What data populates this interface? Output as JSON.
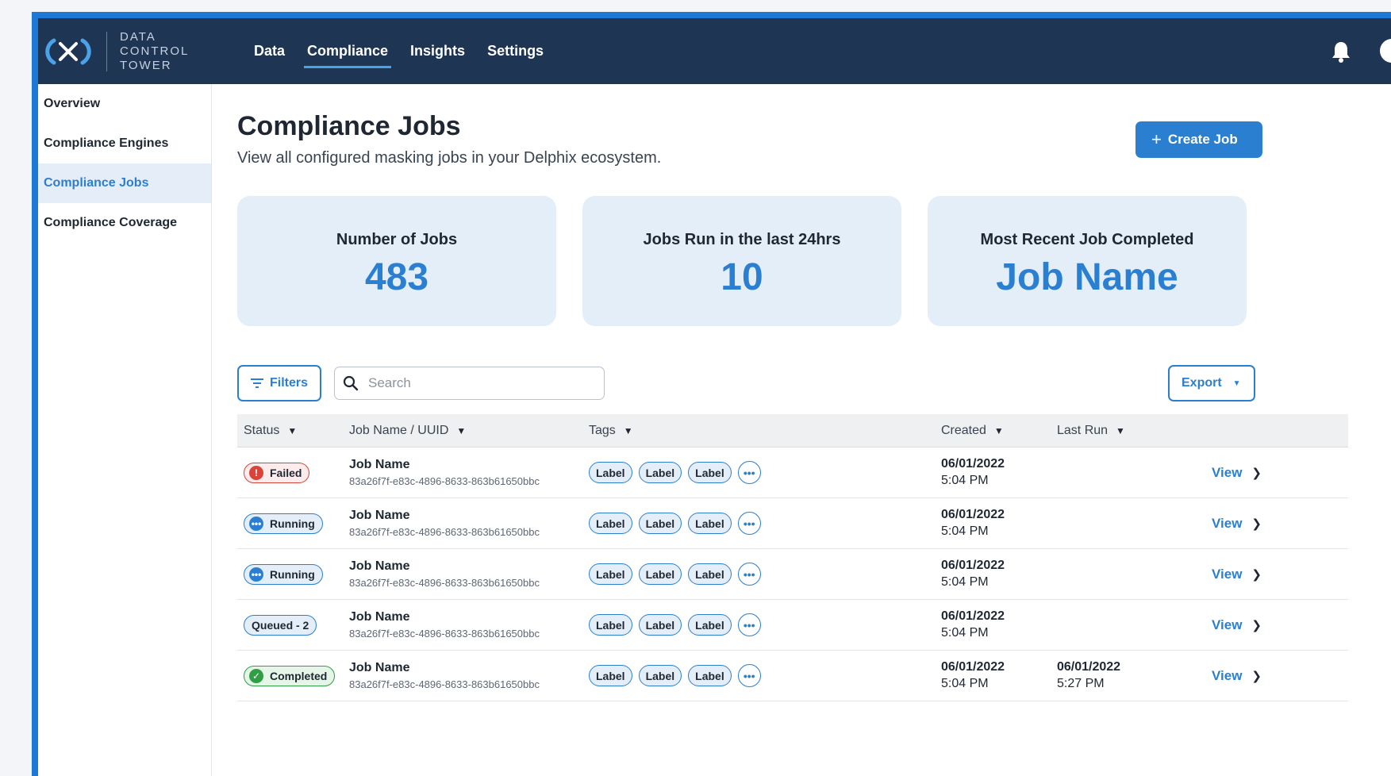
{
  "header": {
    "logo_line1": "DATA",
    "logo_line2": "CONTROL",
    "logo_line3": "TOWER",
    "nav": [
      {
        "label": "Data",
        "active": false
      },
      {
        "label": "Compliance",
        "active": true
      },
      {
        "label": "Insights",
        "active": false
      },
      {
        "label": "Settings",
        "active": false
      }
    ]
  },
  "sidebar": {
    "items": [
      {
        "label": "Overview"
      },
      {
        "label": "Compliance Engines"
      },
      {
        "label": "Compliance Jobs",
        "active": true
      },
      {
        "label": "Compliance Coverage"
      }
    ]
  },
  "page": {
    "title": "Compliance Jobs",
    "subtitle": "View all configured masking jobs in your Delphix ecosystem.",
    "create_label": "Create Job"
  },
  "stats": [
    {
      "label": "Number of Jobs",
      "value": "483"
    },
    {
      "label": "Jobs Run in the last 24hrs",
      "value": "10"
    },
    {
      "label": "Most Recent Job Completed",
      "value": "Job Name"
    }
  ],
  "toolbar": {
    "filters_label": "Filters",
    "search_placeholder": "Search",
    "export_label": "Export"
  },
  "table": {
    "headers": {
      "status": "Status",
      "job": "Job Name / UUID",
      "tags": "Tags",
      "created": "Created",
      "last_run": "Last Run"
    },
    "rows": [
      {
        "status": "Failed",
        "status_type": "failed",
        "name": "Job Name",
        "uuid": "83a26f7f-e83c-4896-8633-863b61650bbc",
        "tags": [
          "Label",
          "Label",
          "Label"
        ],
        "created_date": "06/01/2022",
        "created_time": "5:04 PM",
        "last_date": "",
        "last_time": "",
        "action": "View"
      },
      {
        "status": "Running",
        "status_type": "running",
        "name": "Job Name",
        "uuid": "83a26f7f-e83c-4896-8633-863b61650bbc",
        "tags": [
          "Label",
          "Label",
          "Label"
        ],
        "created_date": "06/01/2022",
        "created_time": "5:04 PM",
        "last_date": "",
        "last_time": "",
        "action": "View"
      },
      {
        "status": "Running",
        "status_type": "running",
        "name": "Job Name",
        "uuid": "83a26f7f-e83c-4896-8633-863b61650bbc",
        "tags": [
          "Label",
          "Label",
          "Label"
        ],
        "created_date": "06/01/2022",
        "created_time": "5:04 PM",
        "last_date": "",
        "last_time": "",
        "action": "View"
      },
      {
        "status": "Queued - 2",
        "status_type": "queued",
        "name": "Job Name",
        "uuid": "83a26f7f-e83c-4896-8633-863b61650bbc",
        "tags": [
          "Label",
          "Label",
          "Label"
        ],
        "created_date": "06/01/2022",
        "created_time": "5:04 PM",
        "last_date": "",
        "last_time": "",
        "action": "View"
      },
      {
        "status": "Completed",
        "status_type": "completed",
        "name": "Job Name",
        "uuid": "83a26f7f-e83c-4896-8633-863b61650bbc",
        "tags": [
          "Label",
          "Label",
          "Label"
        ],
        "created_date": "06/01/2022",
        "created_time": "5:04 PM",
        "last_date": "06/01/2022",
        "last_time": "5:27 PM",
        "action": "View"
      }
    ]
  },
  "colors": {
    "nav_bg": "#1f3554",
    "accent": "#2a7fd1",
    "failed": "#d9443a",
    "completed": "#2f9e44",
    "card_bg": "#e4eef9"
  }
}
